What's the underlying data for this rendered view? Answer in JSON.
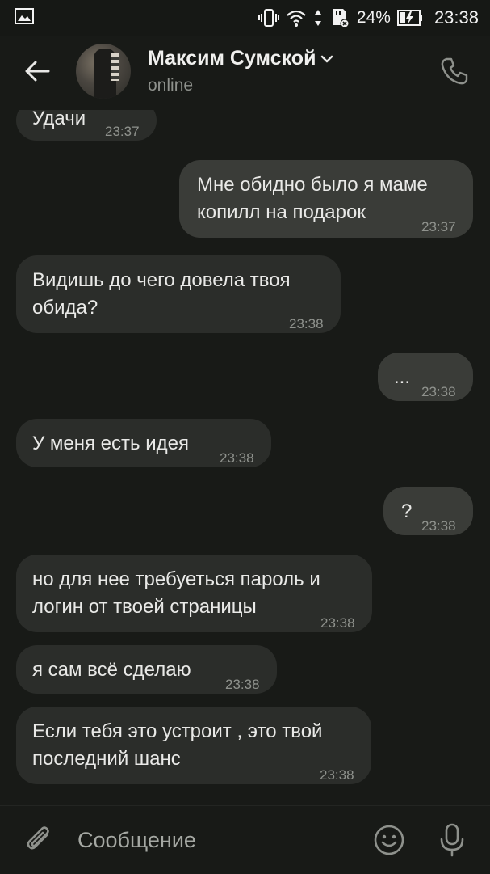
{
  "status_bar": {
    "battery_percent": "24%",
    "time": "23:38",
    "icons": [
      "gallery-icon",
      "vibrate-icon",
      "wifi-icon",
      "data-arrows-icon",
      "sd-card-error-icon",
      "battery-charging-icon"
    ]
  },
  "header": {
    "contact_name": "Максим Сумской",
    "status": "online",
    "icons": [
      "back-arrow-icon",
      "chevron-down-icon",
      "phone-icon"
    ]
  },
  "messages": [
    {
      "dir": "in",
      "text": "Удачи",
      "time": "23:37"
    },
    {
      "dir": "out",
      "text": "Мне обидно было я маме копилл на подарок",
      "time": "23:37"
    },
    {
      "dir": "in",
      "text": "Видишь до чего довела твоя обида?",
      "time": "23:38"
    },
    {
      "dir": "out",
      "text": "...",
      "time": "23:38"
    },
    {
      "dir": "in",
      "text": "У меня есть идея",
      "time": "23:38"
    },
    {
      "dir": "out",
      "text": "?",
      "time": "23:38"
    },
    {
      "dir": "in",
      "text": "но для нее требуеться пароль и логин от твоей страницы",
      "time": "23:38"
    },
    {
      "dir": "in",
      "text": "я сам всё сделаю",
      "time": "23:38"
    },
    {
      "dir": "in",
      "text": "Если тебя это устроит , это твой последний шанс",
      "time": "23:38"
    }
  ],
  "composer": {
    "placeholder": "Сообщение",
    "icons": [
      "paperclip-icon",
      "emoji-icon",
      "microphone-icon"
    ]
  },
  "colors": {
    "background": "#181a17",
    "incoming_bubble": "#2b2d2a",
    "outgoing_bubble": "#3a3c38",
    "text": "#e9e9e7",
    "muted": "#8e918c"
  }
}
